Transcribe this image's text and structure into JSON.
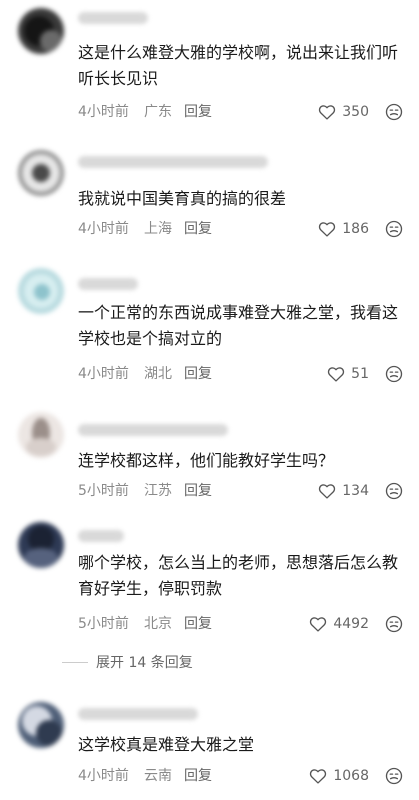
{
  "comments": [
    {
      "text": "这是什么难登大雅的学校啊，说出来让我们听听长长见识",
      "time": "4小时前",
      "location": "广东",
      "reply": "回复",
      "likes": "350"
    },
    {
      "text": "我就说中国美育真的搞的很差",
      "time": "4小时前",
      "location": "上海",
      "reply": "回复",
      "likes": "186"
    },
    {
      "text": "一个正常的东西说成事难登大雅之堂，我看这学校也是个搞对立的",
      "time": "4小时前",
      "location": "湖北",
      "reply": "回复",
      "likes": "51"
    },
    {
      "text": "连学校都这样，他们能教好学生吗？",
      "time": "5小时前",
      "location": "江苏",
      "reply": "回复",
      "likes": "134"
    },
    {
      "text": "哪个学校，怎么当上的老师，思想落后怎么教育好学生，停职罚款",
      "time": "5小时前",
      "location": "北京",
      "reply": "回复",
      "likes": "4492"
    },
    {
      "text": "这学校真是难登大雅之堂",
      "time": "4小时前",
      "location": "云南",
      "reply": "回复",
      "likes": "1068"
    }
  ],
  "expand_replies": "展开 14 条回复",
  "icons": {
    "like": "heart-outline-icon",
    "dislike": "dislike-face-icon"
  }
}
